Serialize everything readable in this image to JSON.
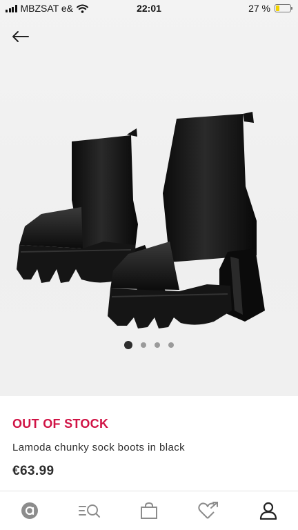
{
  "status_bar": {
    "carrier": "MBZSAT e&",
    "time": "22:01",
    "battery": "27 %",
    "battery_level": 0.27,
    "icons": [
      "signal-icon",
      "wifi-icon",
      "battery-icon"
    ]
  },
  "navigation": {
    "back_icon": "arrow-left-icon"
  },
  "gallery": {
    "image_count": 4,
    "active_index": 0
  },
  "product": {
    "stock_status": "OUT OF STOCK",
    "name": "Lamoda chunky sock boots in black",
    "price": "€63.99"
  },
  "tab_bar": {
    "items": [
      "home-icon",
      "search-icon",
      "bag-icon",
      "saved-icon",
      "account-icon"
    ]
  },
  "colors": {
    "accent": "#d01345",
    "text": "#2d2d2d",
    "battery": "#f2d300"
  }
}
